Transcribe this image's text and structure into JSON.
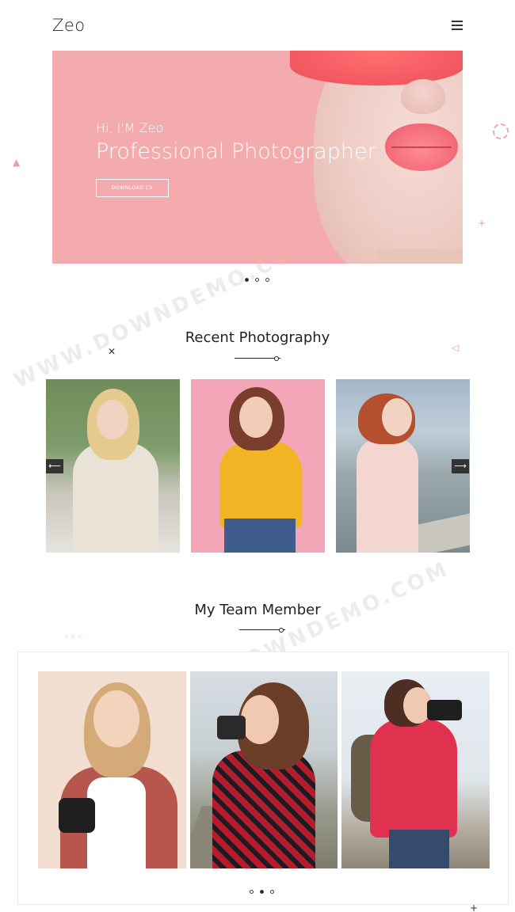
{
  "header": {
    "brand": "Zeo"
  },
  "hero": {
    "subtitle": "Hi, I'M Zeo",
    "title": "Professional Photographer",
    "button_label": "DOWNLOAD CV"
  },
  "hero_slider": {
    "active_index": 0,
    "count": 3
  },
  "recent": {
    "title": "Recent Photography",
    "prev_arrow": "⟵",
    "next_arrow": "⟶"
  },
  "team": {
    "title": "My Team Member",
    "active_index": 1,
    "count": 3
  },
  "colors": {
    "hero_bg": "#f4abae",
    "accent": "#f46e7b"
  }
}
